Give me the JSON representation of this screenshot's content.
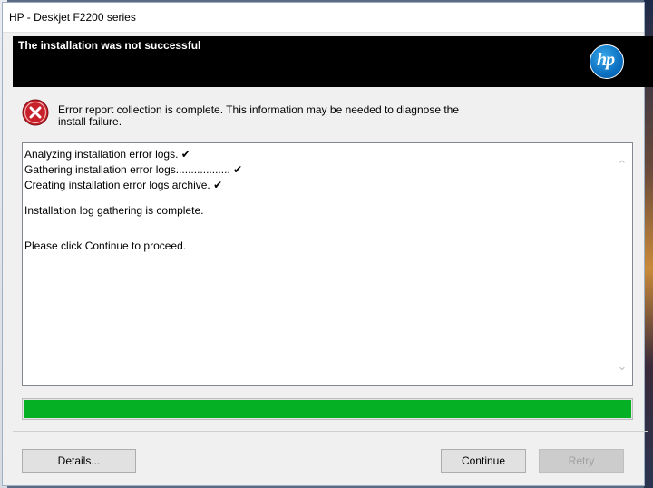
{
  "window": {
    "title": "HP - Deskjet F2200 series"
  },
  "banner": {
    "heading": "The installation was not successful",
    "logo_text": "hp"
  },
  "message": {
    "icon": "error-icon",
    "text": "Error report collection is complete. This information may be needed to diagnose the install failure."
  },
  "log": {
    "lines": [
      "Analyzing installation error logs. ✔",
      "Gathering installation error logs.................. ✔",
      "Creating installation error logs archive. ✔",
      "Installation log gathering is complete.",
      "Please click Continue to proceed."
    ]
  },
  "progress": {
    "value_percent": 100,
    "color": "#06b025"
  },
  "buttons": {
    "details": "Details...",
    "continue": "Continue",
    "retry": "Retry"
  }
}
